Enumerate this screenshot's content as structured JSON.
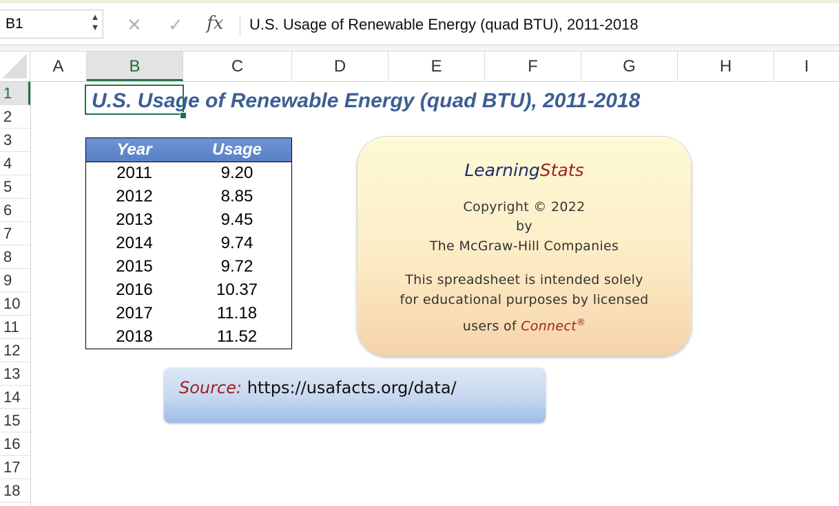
{
  "formula_bar": {
    "name_box": "B1",
    "stepper_up": "▲",
    "stepper_down": "▼",
    "cancel_icon": "✕",
    "enter_icon": "✓",
    "fx_label": "fx",
    "content": "U.S. Usage of Renewable Energy (quad BTU), 2011-2018"
  },
  "columns": [
    "A",
    "B",
    "C",
    "D",
    "E",
    "F",
    "G",
    "H",
    "I"
  ],
  "selected_column": "B",
  "rows": [
    "1",
    "2",
    "3",
    "4",
    "5",
    "6",
    "7",
    "8",
    "9",
    "10",
    "11",
    "12",
    "13",
    "14",
    "15",
    "16",
    "17",
    "18"
  ],
  "selected_row": "1",
  "sheet": {
    "title": "U.S. Usage of Renewable Energy (quad BTU), 2011-2018",
    "table": {
      "headers": [
        "Year",
        "Usage"
      ],
      "rows": [
        [
          "2011",
          "9.20"
        ],
        [
          "2012",
          "8.85"
        ],
        [
          "2013",
          "9.45"
        ],
        [
          "2014",
          "9.74"
        ],
        [
          "2015",
          "9.72"
        ],
        [
          "2016",
          "10.37"
        ],
        [
          "2017",
          "11.18"
        ],
        [
          "2018",
          "11.52"
        ]
      ]
    },
    "copyright_box": {
      "brand_part1": "Learning",
      "brand_part2": "Stats",
      "line1": "Copyright © 2022",
      "line2": "by",
      "line3": "The McGraw-Hill Companies",
      "line4": "This spreadsheet is intended solely",
      "line5": "for educational purposes by licensed",
      "line6_prefix": "users of ",
      "line6_brand": "Connect",
      "line6_mark": "®"
    },
    "source_box": {
      "label": "Source:",
      "url": "https://usafacts.org/data/"
    }
  },
  "colors": {
    "title": "#3c5f92",
    "table_header": "#5a80c6",
    "selection": "#217346",
    "accent_red": "#a32020"
  }
}
